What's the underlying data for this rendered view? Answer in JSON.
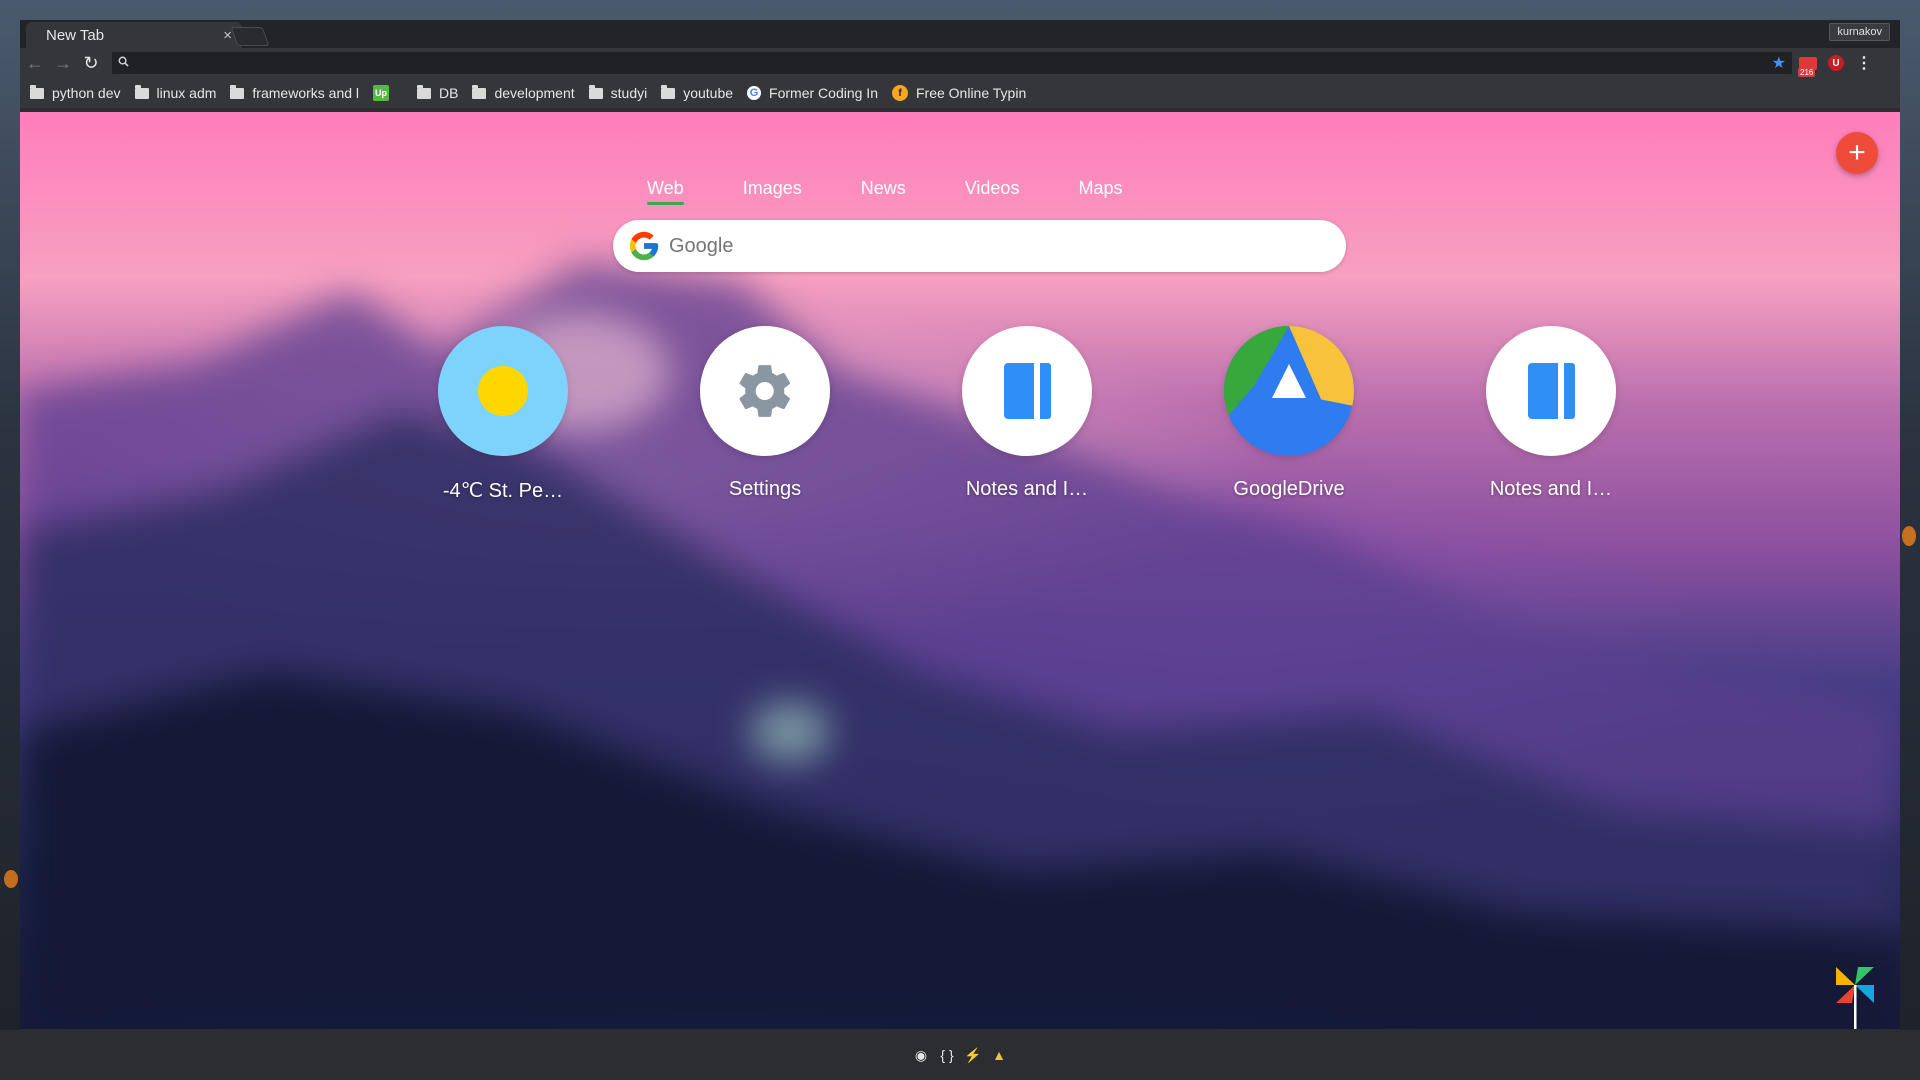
{
  "tab": {
    "title": "New Tab",
    "close": "×"
  },
  "profile": {
    "name": "kurnakov"
  },
  "toolbar": {
    "back": "←",
    "forward": "→",
    "reload": "↻",
    "omnibox_value": "",
    "mail_count": "216",
    "ublock_label": "U",
    "menu": "⋮"
  },
  "bookmarks": [
    {
      "label": "python dev",
      "icon": "folder-icon"
    },
    {
      "label": "linux adm",
      "icon": "folder-icon"
    },
    {
      "label": "frameworks and l",
      "icon": "folder-icon"
    },
    {
      "label": "Up",
      "icon": "upwork-icon"
    },
    {
      "label": "DB",
      "icon": "folder-icon"
    },
    {
      "label": "development",
      "icon": "folder-icon"
    },
    {
      "label": "studyi",
      "icon": "folder-icon"
    },
    {
      "label": "youtube",
      "icon": "folder-icon"
    },
    {
      "label": "Former Coding In",
      "icon": "google-icon"
    },
    {
      "label": "Free Online Typin",
      "icon": "typing-icon"
    }
  ],
  "search": {
    "tabs": [
      "Web",
      "Images",
      "News",
      "Videos",
      "Maps"
    ],
    "active_tab": "Web",
    "placeholder": "Google"
  },
  "add_button": "+",
  "shortcuts": [
    {
      "label": "-4℃ St. Pe…",
      "icon": "weather-sun-icon"
    },
    {
      "label": "Settings",
      "icon": "gear-icon"
    },
    {
      "label": "Notes and I…",
      "icon": "notes-icon"
    },
    {
      "label": "GoogleDrive",
      "icon": "google-drive-icon"
    },
    {
      "label": "Notes and I…",
      "icon": "notes-icon"
    }
  ],
  "dock": [
    "◉",
    "{ }",
    "⚡",
    "▲"
  ],
  "colors": {
    "accent_green": "#34a853",
    "fab_red": "#ef4b3a",
    "weather_bg": "#7dd3fb",
    "sun_yellow": "#ffd600",
    "notes_blue": "#2f8ff5"
  }
}
